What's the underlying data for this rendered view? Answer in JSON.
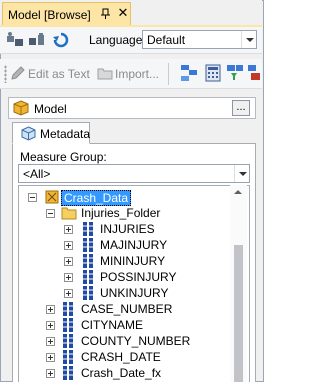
{
  "window": {
    "title": "Model [Browse]",
    "pin_icon": "pin-icon",
    "close_icon": "close-icon"
  },
  "toolbar1": {
    "icons": [
      "connect-icon",
      "change-user-icon",
      "refresh-icon"
    ],
    "language_label": "Language:",
    "language_value": "Default"
  },
  "toolbar2": {
    "edit_as_text": "Edit as Text",
    "import": "Import...",
    "icons": [
      "design-mode-icon",
      "calculator-icon",
      "filter-icon",
      "dimension-icon"
    ]
  },
  "model": {
    "name": "Model",
    "ellipsis": "..."
  },
  "tabs": {
    "metadata": "Metadata"
  },
  "measure_group": {
    "label": "Measure Group:",
    "value": "<All>"
  },
  "tree": {
    "root": "Crash_Data",
    "folder": "Injuries_Folder",
    "folder_items": [
      "INJURIES",
      "MAJINJURY",
      "MININJURY",
      "POSSINJURY",
      "UNKINJURY"
    ],
    "items": [
      "CASE_NUMBER",
      "CITYNAME",
      "COUNTY_NUMBER",
      "CRASH_DATE",
      "Crash_Date_fx"
    ]
  },
  "colors": {
    "selection": "#3399ff",
    "title_tab": "#fde5a6"
  }
}
